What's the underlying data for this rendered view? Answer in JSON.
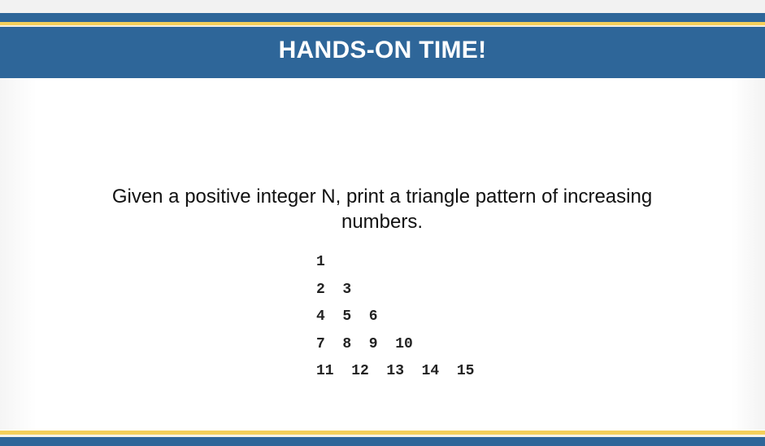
{
  "slide": {
    "title": "HANDS-ON TIME!",
    "prompt": "Given a positive integer N, print a triangle pattern of increasing numbers.",
    "pattern_rows": [
      "1",
      "2  3",
      "4  5  6",
      "7  8  9  10",
      "11  12  13  14  15"
    ]
  },
  "colors": {
    "header_blue": "#2e6699",
    "accent_gold": "#f4cf5a",
    "title_text": "#ffffff",
    "body_text": "#111111"
  }
}
